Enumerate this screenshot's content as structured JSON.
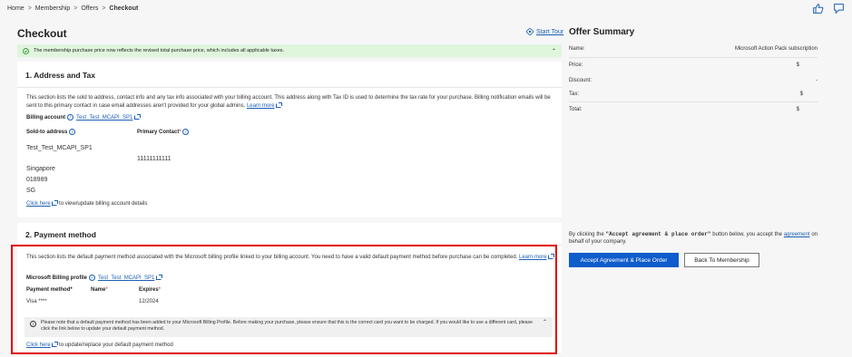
{
  "breadcrumb": {
    "home": "Home",
    "membership": "Membership",
    "offers": "Offers",
    "checkout": "Checkout"
  },
  "page": {
    "title": "Checkout",
    "start_tour": "Start Tour"
  },
  "banner": {
    "text": "The membership purchase price now reflects the revised total purchase price, which includes all applicable taxes."
  },
  "address": {
    "heading": "1. Address and Tax",
    "description": "This section lists the sold to address, contact info and any tax info associated with your billing account. This address along with Tax ID is used to determine the tax rate for your purchase. Billing notification emails will be sent to this primary contact in case email addresses aren't provided for your global admins.",
    "learn_more": "Learn more",
    "billing_account_label": "Billing account",
    "billing_account_value": "Test_Test_MCAPI_SP1",
    "sold_to_label": "Sold-to address",
    "primary_contact_label": "Primary Contact",
    "sold_to_name": "Test_Test_MCAPI_SP1",
    "primary_contact_value": "11111111111",
    "city": "Singapore",
    "postal": "018989",
    "country": "SG",
    "click_here": "Click here",
    "click_here_suffix": "to view/update billing account details"
  },
  "payment": {
    "heading": "2. Payment method",
    "description": "This section lists the default payment method associated with the Microsoft billing profile linked to your billing account. You need to have a valid default payment method before purchase can be completed.",
    "learn_more": "Learn more",
    "billing_profile_label": "Microsoft Billing profile",
    "billing_profile_value": "Test_Test_MCAPI_SP1",
    "col_method": "Payment method*",
    "col_name": "Name",
    "col_expires": "Expires",
    "method_value": "Visa ****",
    "name_value": "",
    "expires_value": "12/2024",
    "notice": "Please note that a default payment method has been added to your Microsoft Billing Profile. Before making your purchase, please ensure that this is the correct card you want to be charged. If you would like to use a different card, please click the link below to update your default payment method.",
    "click_here": "Click here",
    "click_here_suffix": "to update/replace your default payment method"
  },
  "summary": {
    "title": "Offer Summary",
    "name_label": "Name:",
    "name_value": "Microsoft Action Pack subscription",
    "price_label": "Price:",
    "price_value": "$",
    "discount_label": "Discount:",
    "discount_value": "-",
    "tax_label": "Tax:",
    "tax_value": "$",
    "total_label": "Total:",
    "total_value": "$"
  },
  "agreement": {
    "prefix": "By clicking the",
    "button_ref": "\"Accept agreement & place order\"",
    "middle": "button below, you accept the",
    "link": "agreement",
    "suffix": "on behalf of your company.",
    "accept_button": "Accept Agreement & Place Order",
    "back_button": "Back To Membership"
  },
  "colors": {
    "primary": "#0f5ccc",
    "link": "#1a5fb4",
    "banner": "#dff6dd",
    "highlight": "#e00000"
  }
}
